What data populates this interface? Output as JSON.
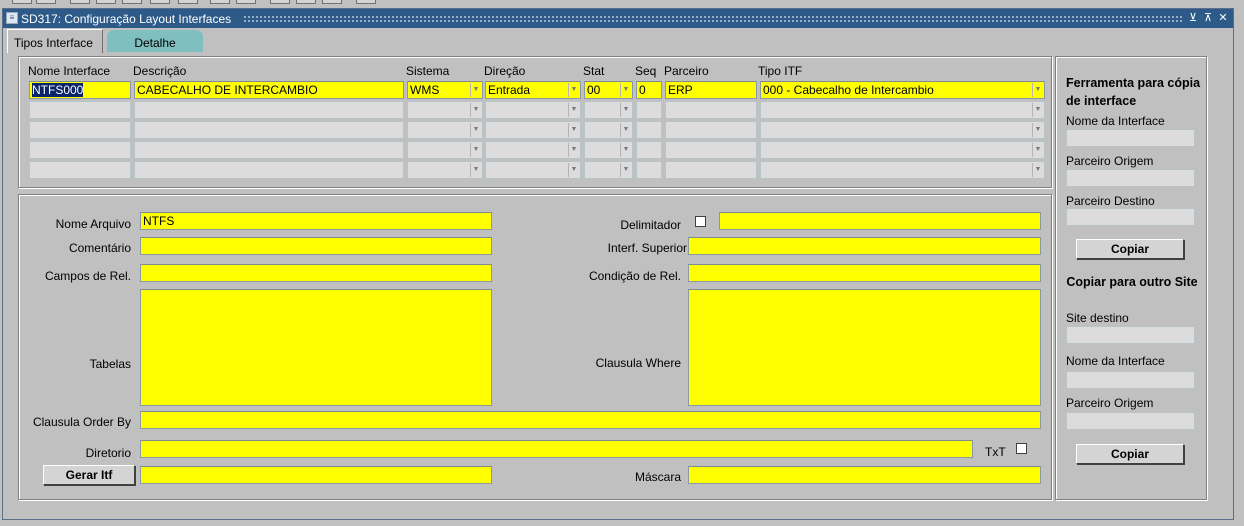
{
  "window": {
    "title": "SD317: Configuração Layout Interfaces"
  },
  "tabs": [
    {
      "label": "Tipos Interface"
    },
    {
      "label": "Detalhe"
    }
  ],
  "grid": {
    "headers": [
      "Nome Interface",
      "Descrição",
      "Sistema",
      "Direção",
      "Stat",
      "Seq",
      "Parceiro",
      "Tipo ITF"
    ],
    "row1": {
      "nome": "NTFS000",
      "descricao": "CABECALHO DE INTERCAMBIO",
      "sistema": "WMS",
      "direcao": "Entrada",
      "stat": "00",
      "seq": "0",
      "parceiro": "ERP",
      "tipo_itf": "000 - Cabecalho de Intercambio"
    }
  },
  "detail": {
    "nome_arquivo_label": "Nome Arquivo",
    "nome_arquivo_value": "NTFS",
    "comentario_label": "Comentário",
    "campos_rel_label": "Campos de Rel.",
    "tabelas_label": "Tabelas",
    "delimitador_label": "Delimitador",
    "interf_superior_label": "Interf. Superior",
    "condicao_rel_label": "Condição de Rel.",
    "clausula_where_label": "Clausula Where",
    "clausula_order_label": "Clausula Order By",
    "diretorio_label": "Diretorio",
    "txt_label": "TxT",
    "gerar_itf_label": "Gerar Itf",
    "mascara_label": "Máscara"
  },
  "tool": {
    "title": "Ferramenta para cópia de interface",
    "nome_interface_label": "Nome da Interface",
    "parceiro_origem_label": "Parceiro Origem",
    "parceiro_destino_label": "Parceiro Destino",
    "copiar_label": "Copiar",
    "site_title": "Copiar para outro Site",
    "site_destino_label": "Site destino",
    "nome_interface2_label": "Nome da Interface",
    "parceiro_origem2_label": "Parceiro Origem",
    "copiar2_label": "Copiar"
  }
}
